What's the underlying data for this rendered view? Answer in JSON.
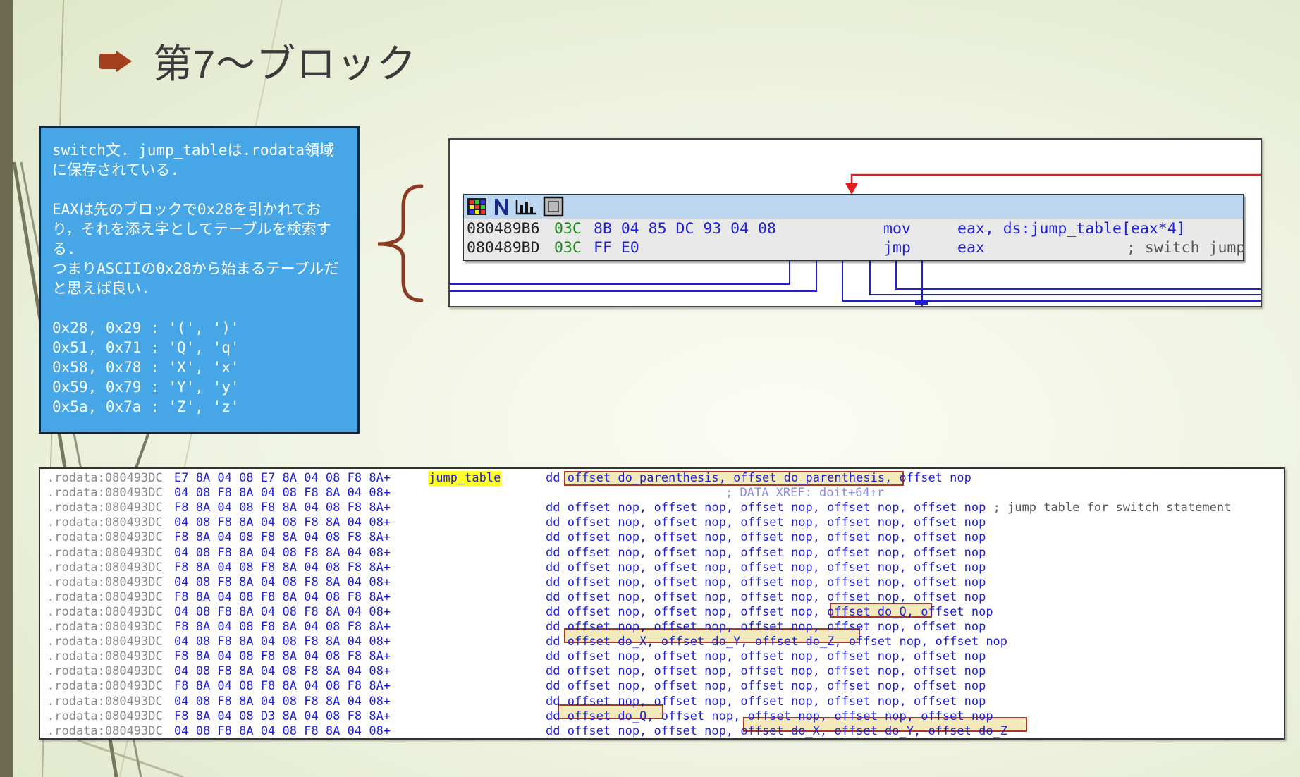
{
  "slide": {
    "title": "第7〜ブロック"
  },
  "note": {
    "para1": "switch文. jump_tableは.rodata領域に保存されている.",
    "para2": "EAXは先のブロックで0x28を引かれており，それを添え字としてテーブルを検索する.",
    "para3": "つまりASCIIの0x28から始まるテーブルだと思えば良い.",
    "codes": [
      "0x28, 0x29 : '(', ')'",
      "0x51, 0x71 : 'Q', 'q'",
      "0x58, 0x78 : 'X', 'x'",
      "0x59, 0x79 : 'Y', 'y'",
      "0x5a, 0x7a : 'Z', 'z'"
    ]
  },
  "graph": {
    "node_icons": [
      "grid-icon",
      "n-icon",
      "chart-icon",
      "frame-icon"
    ],
    "instructions": [
      {
        "addr": "080489B6",
        "b1": "03C",
        "b2": "8B 04 85 DC 93 04 08",
        "mnemonic": "mov",
        "operand": "eax, ds:jump_table[eax*4]",
        "comment": ""
      },
      {
        "addr": "080489BD",
        "b1": "03C",
        "b2": "FF E0",
        "mnemonic": "jmp",
        "operand": "eax",
        "comment": "; switch jump"
      }
    ]
  },
  "listing": {
    "label": "jump_table",
    "xref": "; DATA XREF: doit+64↑r",
    "rows": [
      {
        "seg": ".rodata:080493DC",
        "hex": "E7 8A 04 08 E7 8A 04 08 F8 8A+",
        "dd": "dd offset do_parenthesis, offset do_parenthesis, offset nop",
        "cmt": ""
      },
      {
        "seg": ".rodata:080493DC",
        "hex": "04 08 F8 8A 04 08 F8 8A 04 08+",
        "dd": "",
        "cmt": ""
      },
      {
        "seg": ".rodata:080493DC",
        "hex": "F8 8A 04 08 F8 8A 04 08 F8 8A+",
        "dd": "dd offset nop, offset nop, offset nop, offset nop, offset nop",
        "cmt": " ; jump table for switch statement"
      },
      {
        "seg": ".rodata:080493DC",
        "hex": "04 08 F8 8A 04 08 F8 8A 04 08+",
        "dd": "dd offset nop, offset nop, offset nop, offset nop, offset nop",
        "cmt": ""
      },
      {
        "seg": ".rodata:080493DC",
        "hex": "F8 8A 04 08 F8 8A 04 08 F8 8A+",
        "dd": "dd offset nop, offset nop, offset nop, offset nop, offset nop",
        "cmt": ""
      },
      {
        "seg": ".rodata:080493DC",
        "hex": "04 08 F8 8A 04 08 F8 8A 04 08+",
        "dd": "dd offset nop, offset nop, offset nop, offset nop, offset nop",
        "cmt": ""
      },
      {
        "seg": ".rodata:080493DC",
        "hex": "F8 8A 04 08 F8 8A 04 08 F8 8A+",
        "dd": "dd offset nop, offset nop, offset nop, offset nop, offset nop",
        "cmt": ""
      },
      {
        "seg": ".rodata:080493DC",
        "hex": "04 08 F8 8A 04 08 F8 8A 04 08+",
        "dd": "dd offset nop, offset nop, offset nop, offset nop, offset nop",
        "cmt": ""
      },
      {
        "seg": ".rodata:080493DC",
        "hex": "F8 8A 04 08 F8 8A 04 08 F8 8A+",
        "dd": "dd offset nop, offset nop, offset nop, offset nop, offset nop",
        "cmt": ""
      },
      {
        "seg": ".rodata:080493DC",
        "hex": "04 08 F8 8A 04 08 F8 8A 04 08+",
        "dd": "dd offset nop, offset nop, offset nop, offset do_Q, offset nop",
        "cmt": ""
      },
      {
        "seg": ".rodata:080493DC",
        "hex": "F8 8A 04 08 F8 8A 04 08 F8 8A+",
        "dd": "dd offset nop, offset nop, offset nop, offset nop, offset nop",
        "cmt": ""
      },
      {
        "seg": ".rodata:080493DC",
        "hex": "04 08 F8 8A 04 08 F8 8A 04 08+",
        "dd": "dd offset do_X, offset do_Y, offset do_Z, offset nop, offset nop",
        "cmt": ""
      },
      {
        "seg": ".rodata:080493DC",
        "hex": "F8 8A 04 08 F8 8A 04 08 F8 8A+",
        "dd": "dd offset nop, offset nop, offset nop, offset nop, offset nop",
        "cmt": ""
      },
      {
        "seg": ".rodata:080493DC",
        "hex": "04 08 F8 8A 04 08 F8 8A 04 08+",
        "dd": "dd offset nop, offset nop, offset nop, offset nop, offset nop",
        "cmt": ""
      },
      {
        "seg": ".rodata:080493DC",
        "hex": "F8 8A 04 08 F8 8A 04 08 F8 8A+",
        "dd": "dd offset nop, offset nop, offset nop, offset nop, offset nop",
        "cmt": ""
      },
      {
        "seg": ".rodata:080493DC",
        "hex": "04 08 F8 8A 04 08 F8 8A 04 08+",
        "dd": "dd offset nop, offset nop, offset nop, offset nop, offset nop",
        "cmt": ""
      },
      {
        "seg": ".rodata:080493DC",
        "hex": "F8 8A 04 08 D3 8A 04 08 F8 8A+",
        "dd": "dd offset do_Q, offset nop, offset nop, offset nop, offset nop",
        "cmt": ""
      },
      {
        "seg": ".rodata:080493DC",
        "hex": "04 08 F8 8A 04 08 F8 8A 04 08+",
        "dd": "dd offset nop, offset nop, offset do_X, offset do_Y, offset do_Z",
        "cmt": ""
      }
    ]
  },
  "colors": {
    "accent_arrow": "#a5401f",
    "note_bg": "#46a6e6",
    "highlight_border": "#a33b2a",
    "label_highlight": "#ffff2a"
  }
}
